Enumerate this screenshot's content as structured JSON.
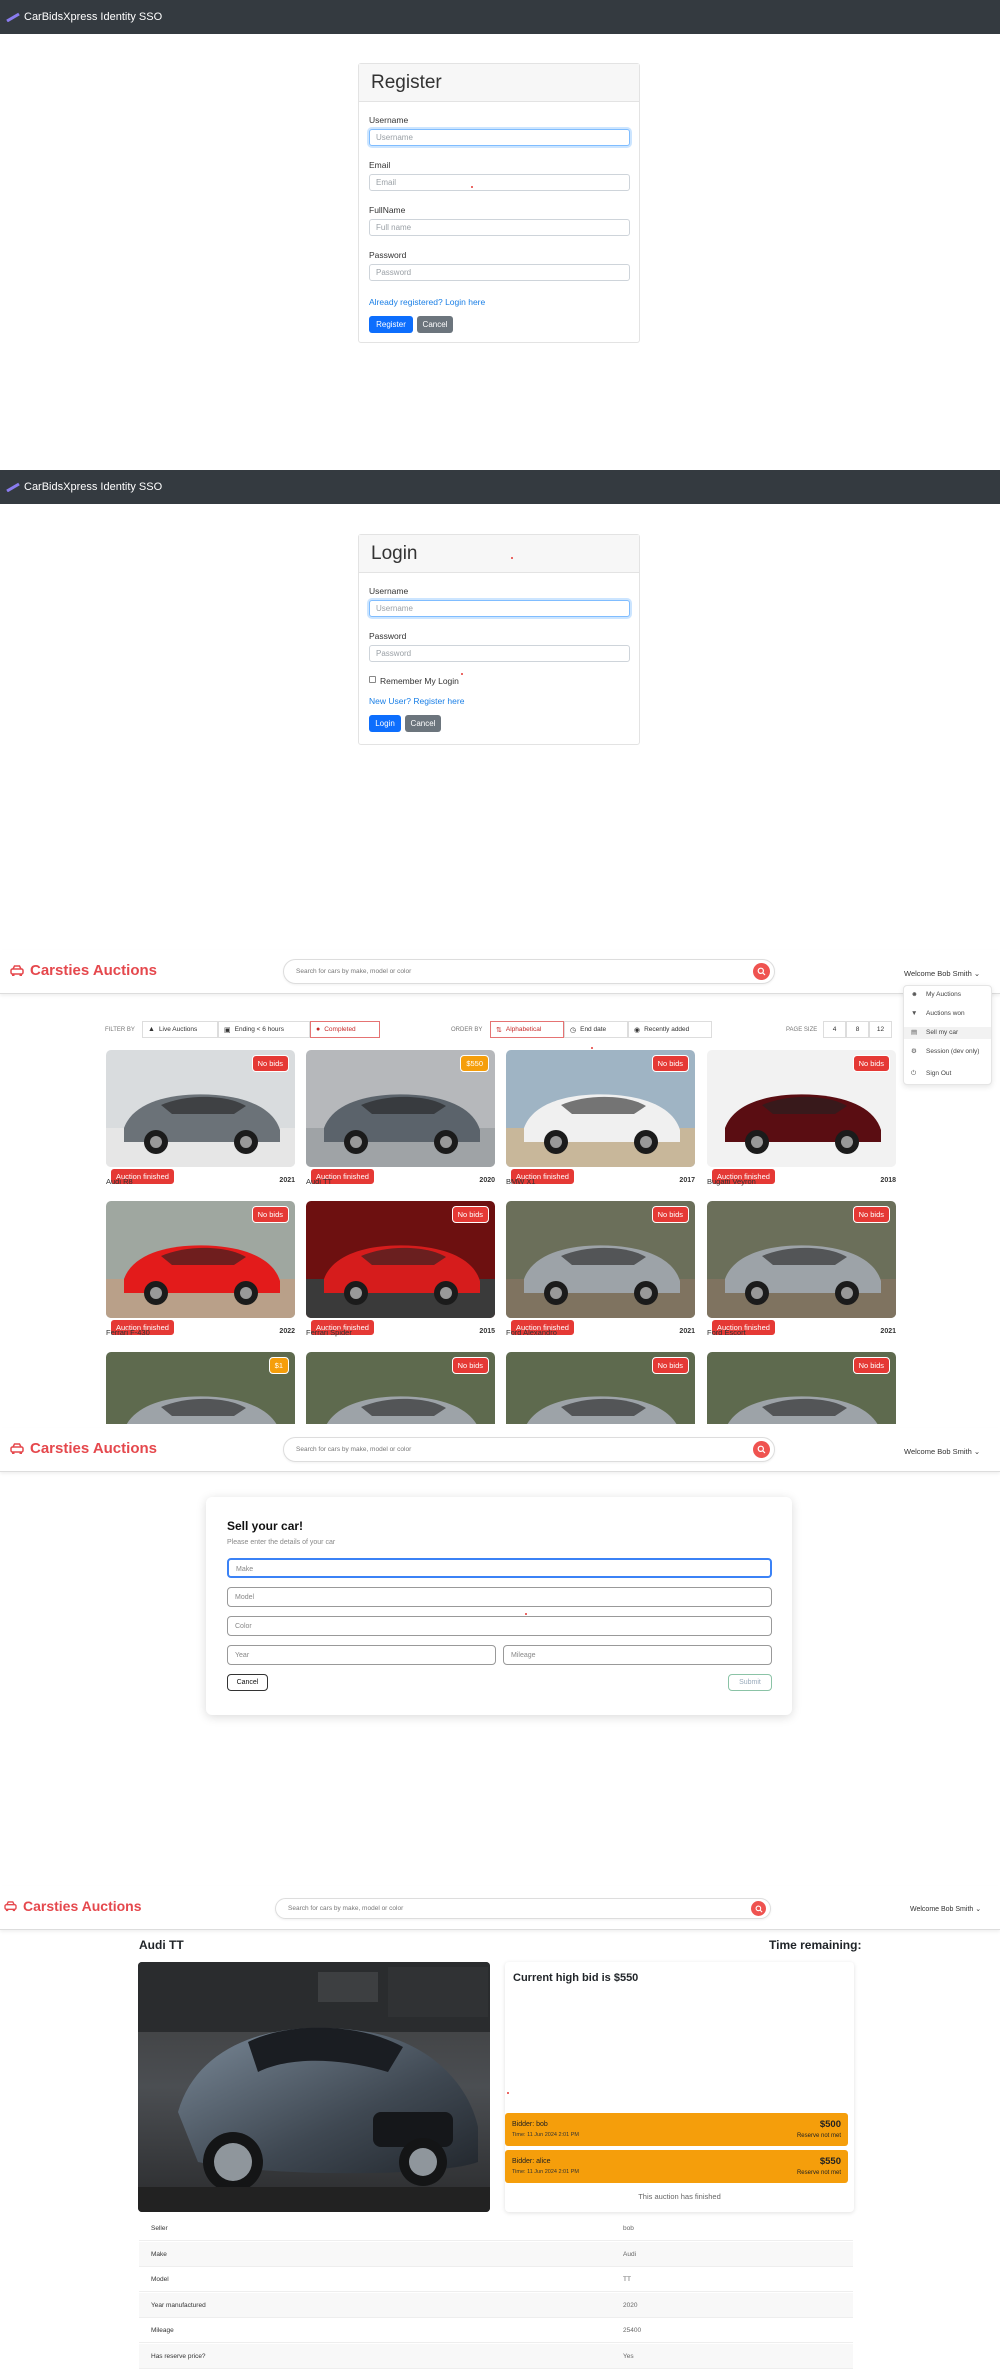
{
  "register": {
    "brand": "CarBidsXpress Identity SSO",
    "title": "Register",
    "fields": [
      {
        "label": "Username",
        "placeholder": "Username"
      },
      {
        "label": "Email",
        "placeholder": "Email"
      },
      {
        "label": "FullName",
        "placeholder": "Full name"
      },
      {
        "label": "Password",
        "placeholder": "Password"
      }
    ],
    "login_link": "Already registered? Login here",
    "register_button": "Register",
    "cancel_button": "Cancel"
  },
  "login": {
    "brand": "CarBidsXpress Identity SSO",
    "title": "Login",
    "fields": [
      {
        "label": "Username",
        "placeholder": "Username"
      },
      {
        "label": "Password",
        "placeholder": "Password"
      }
    ],
    "remember": "Remember My Login",
    "register_link": "New User? Register here",
    "login_button": "Login",
    "cancel_button": "Cancel"
  },
  "app": {
    "brand": "Carsties Auctions",
    "search_placeholder": "Search for cars by make, model or color",
    "user_menu": "Welcome Bob Smith",
    "colors": {
      "brand": "#e5484d",
      "badge_red": "#e53935",
      "badge_orange": "#f59e0b"
    }
  },
  "listing": {
    "filter_label": "FILTER BY",
    "filters": [
      {
        "label": "Live Auctions",
        "icon": "flame-icon"
      },
      {
        "label": "Ending < 6 hours",
        "icon": "hourglass-icon"
      },
      {
        "label": "Completed",
        "icon": "stop-icon"
      }
    ],
    "order_label": "ORDER BY",
    "orders": [
      {
        "label": "Alphabetical",
        "icon": "sort-icon"
      },
      {
        "label": "End date",
        "icon": "clock-icon"
      },
      {
        "label": "Recently added",
        "icon": "new-icon"
      }
    ],
    "page_size_label": "PAGE SIZE",
    "page_sizes": [
      "4",
      "8",
      "12"
    ],
    "dropdown": [
      {
        "label": "My Auctions",
        "icon": "user-icon"
      },
      {
        "label": "Auctions won",
        "icon": "trophy-icon"
      },
      {
        "label": "Sell my car",
        "icon": "car-icon"
      },
      {
        "label": "Session (dev only)",
        "icon": "gear-icon"
      },
      {
        "label": "Sign Out",
        "icon": "power-icon"
      }
    ],
    "finished_label": "Auction finished",
    "cars": [
      {
        "name": "Audi R8",
        "year": "2021",
        "badge": "No bids",
        "badge_kind": "red",
        "finished": true
      },
      {
        "name": "Audi TT",
        "year": "2020",
        "badge": "$550",
        "badge_kind": "orange",
        "finished": true
      },
      {
        "name": "BMW X1",
        "year": "2017",
        "badge": "No bids",
        "badge_kind": "red",
        "finished": true
      },
      {
        "name": "Bugatti Veyron",
        "year": "2018",
        "badge": "No bids",
        "badge_kind": "red",
        "finished": true
      },
      {
        "name": "Ferrari F-430",
        "year": "2022",
        "badge": "No bids",
        "badge_kind": "red",
        "finished": true
      },
      {
        "name": "Ferrari Spider",
        "year": "2015",
        "badge": "No bids",
        "badge_kind": "red",
        "finished": true
      },
      {
        "name": "Ford Alexandro",
        "year": "2021",
        "badge": "No bids",
        "badge_kind": "red",
        "finished": true
      },
      {
        "name": "Ford Escort",
        "year": "2021",
        "badge": "No bids",
        "badge_kind": "red",
        "finished": true
      },
      {
        "name": "",
        "year": "",
        "badge": "$1",
        "badge_kind": "orange",
        "finished": false
      },
      {
        "name": "",
        "year": "",
        "badge": "No bids",
        "badge_kind": "red",
        "finished": false
      },
      {
        "name": "",
        "year": "",
        "badge": "No bids",
        "badge_kind": "red",
        "finished": false
      },
      {
        "name": "",
        "year": "",
        "badge": "No bids",
        "badge_kind": "red",
        "finished": false
      }
    ]
  },
  "sell": {
    "title": "Sell your car!",
    "subtitle": "Please enter the details of your car",
    "make": "Make",
    "model": "Model",
    "color": "Color",
    "year": "Year",
    "mileage": "Mileage",
    "cancel": "Cancel",
    "submit": "Submit"
  },
  "detail": {
    "title": "Audi TT",
    "time_remaining": "Time remaining:",
    "high_bid": "Current high bid is $550",
    "bids": [
      {
        "bidder": "Bidder: bob",
        "time": "Time: 11 Jun 2024 2:01 PM",
        "amount": "$500",
        "status": "Reserve not met"
      },
      {
        "bidder": "Bidder: alice",
        "time": "Time: 11 Jun 2024 2:01 PM",
        "amount": "$550",
        "status": "Reserve not met"
      }
    ],
    "finished": "This auction has finished",
    "specs": [
      {
        "k": "Seller",
        "v": "bob"
      },
      {
        "k": "Make",
        "v": "Audi"
      },
      {
        "k": "Model",
        "v": "TT"
      },
      {
        "k": "Year manufactured",
        "v": "2020"
      },
      {
        "k": "Mileage",
        "v": "25400"
      },
      {
        "k": "Has reserve price?",
        "v": "Yes"
      }
    ]
  }
}
